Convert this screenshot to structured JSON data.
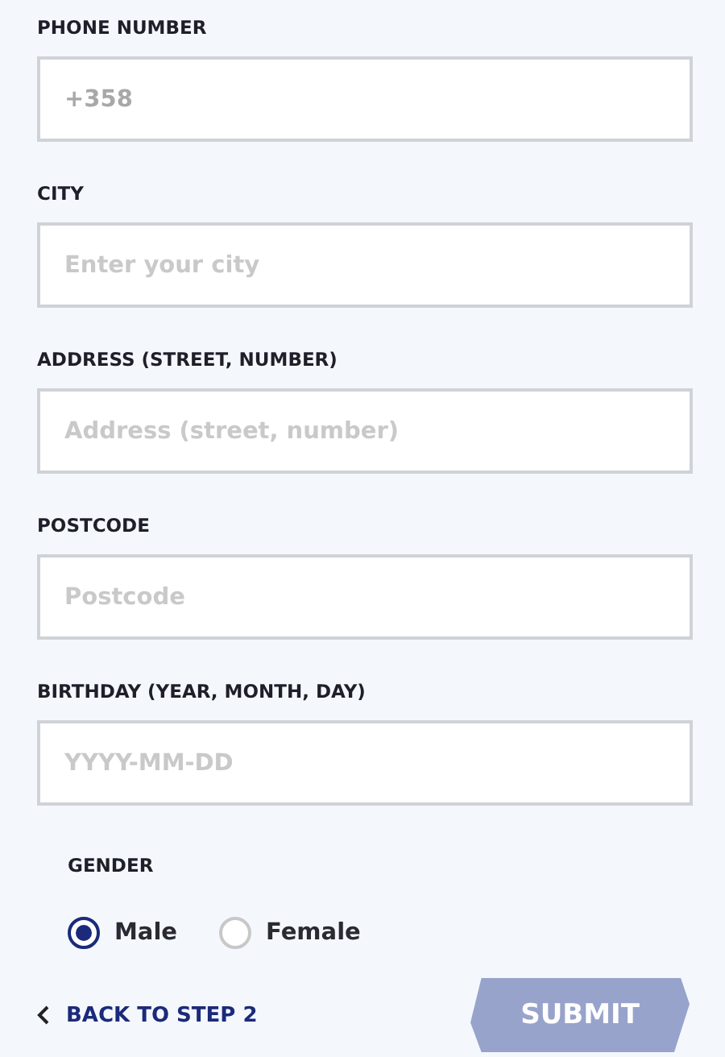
{
  "fields": [
    {
      "label": "PHONE NUMBER",
      "value": "+358"
    },
    {
      "label": "CITY",
      "placeholder": "Enter your city"
    },
    {
      "label": "ADDRESS (STREET, NUMBER)",
      "placeholder": "Address (street, number)"
    },
    {
      "label": "POSTCODE",
      "placeholder": "Postcode"
    },
    {
      "label": "BIRTHDAY (YEAR, MONTH, DAY)",
      "placeholder": "YYYY-MM-DD"
    }
  ],
  "gender": {
    "label": "GENDER",
    "options": [
      {
        "label": "Male",
        "selected": true
      },
      {
        "label": "Female",
        "selected": false
      }
    ]
  },
  "back_link": "BACK TO STEP 2",
  "submit": {
    "label": "SUBMIT",
    "disabled": true
  }
}
